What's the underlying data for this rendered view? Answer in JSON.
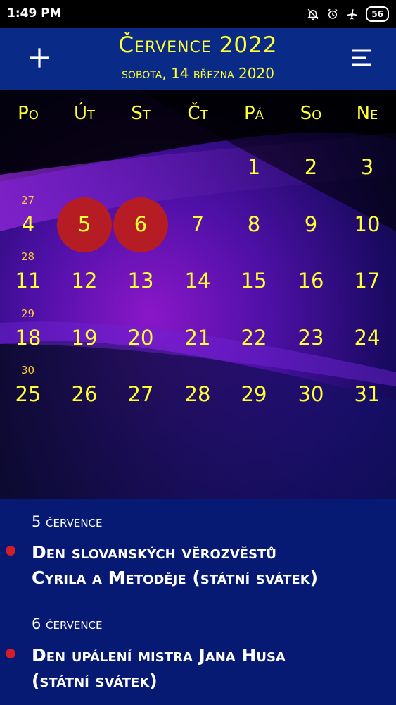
{
  "status_bar": {
    "time": "1:49 PM",
    "battery": "56",
    "icons": [
      "bell-off-icon",
      "alarm-icon",
      "airplane-icon",
      "battery-icon"
    ]
  },
  "header": {
    "title": "Července 2022",
    "subtitle": "sobota, 14 března 2020",
    "add_icon": "plus-icon",
    "menu_icon": "menu-icon"
  },
  "calendar": {
    "weekdays": [
      "Po",
      "Út",
      "St",
      "Čt",
      "Pá",
      "So",
      "Ne"
    ],
    "weeks": [
      {
        "week": "",
        "days": [
          "",
          "",
          "",
          "",
          "1",
          "2",
          "3"
        ]
      },
      {
        "week": "27",
        "days": [
          "4",
          "5",
          "6",
          "7",
          "8",
          "9",
          "10"
        ]
      },
      {
        "week": "28",
        "days": [
          "11",
          "12",
          "13",
          "14",
          "15",
          "16",
          "17"
        ]
      },
      {
        "week": "29",
        "days": [
          "18",
          "19",
          "20",
          "21",
          "22",
          "23",
          "24"
        ]
      },
      {
        "week": "30",
        "days": [
          "25",
          "26",
          "27",
          "28",
          "29",
          "30",
          "31"
        ]
      }
    ],
    "holidays": [
      "5",
      "6"
    ]
  },
  "holiday_list": [
    {
      "date": "5 července",
      "title_line1": "Den slovanských věrozvěstů",
      "title_line2": "Cyrila a Metoděje (státní svátek)"
    },
    {
      "date": "6 července",
      "title_line1": "Den upálení mistra Jana Husa",
      "title_line2": "(státní svátek)"
    }
  ],
  "colors": {
    "accent_text": "#ffff33",
    "header_bg": "#0a2a88",
    "holiday_circle": "#b51c24",
    "list_bg": "#071a73"
  }
}
